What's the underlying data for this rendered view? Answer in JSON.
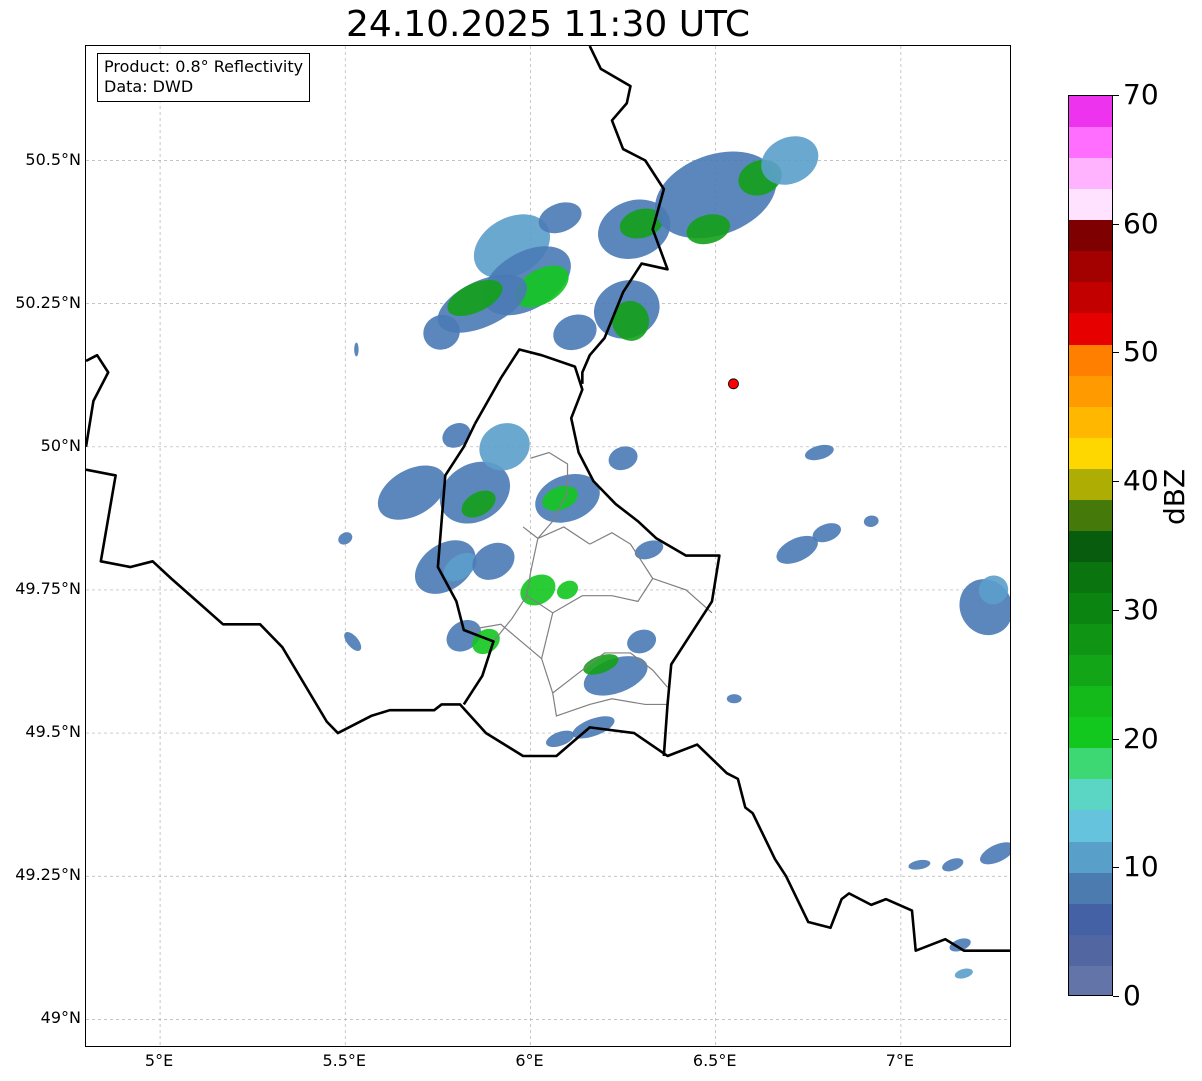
{
  "title": "24.10.2025 11:30 UTC",
  "info": {
    "line1": "Product: 0.8° Reflectivity",
    "line2": "Data: DWD"
  },
  "map": {
    "lon_range": [
      4.8,
      7.3
    ],
    "lat_range": [
      48.95,
      50.7
    ],
    "grid": true,
    "lat_ticks": [
      {
        "value": 50.5,
        "label": "50.5°N"
      },
      {
        "value": 50.25,
        "label": "50.25°N"
      },
      {
        "value": 50.0,
        "label": "50°N"
      },
      {
        "value": 49.75,
        "label": "49.75°N"
      },
      {
        "value": 49.5,
        "label": "49.5°N"
      },
      {
        "value": 49.25,
        "label": "49.25°N"
      },
      {
        "value": 49.0,
        "label": "49°N"
      }
    ],
    "lon_ticks": [
      {
        "value": 5.0,
        "label": "5°E"
      },
      {
        "value": 5.5,
        "label": "5.5°E"
      },
      {
        "value": 6.0,
        "label": "6°E"
      },
      {
        "value": 6.5,
        "label": "6.5°E"
      },
      {
        "value": 7.0,
        "label": "7°E"
      }
    ],
    "radar_site": {
      "lon": 6.548,
      "lat": 50.11,
      "color": "#ff0000"
    },
    "borders": [
      [
        [
          4.8,
          49.96
        ],
        [
          4.88,
          49.95
        ],
        [
          4.84,
          49.8
        ],
        [
          4.92,
          49.79
        ],
        [
          4.98,
          49.8
        ],
        [
          5.03,
          49.77
        ],
        [
          5.1,
          49.73
        ],
        [
          5.17,
          49.69
        ],
        [
          5.27,
          49.69
        ],
        [
          5.33,
          49.65
        ],
        [
          5.45,
          49.52
        ],
        [
          5.48,
          49.5
        ],
        [
          5.57,
          49.53
        ],
        [
          5.62,
          49.54
        ],
        [
          5.74,
          49.54
        ],
        [
          5.76,
          49.55
        ],
        [
          5.81,
          49.55
        ],
        [
          5.88,
          49.5
        ],
        [
          5.98,
          49.46
        ],
        [
          6.07,
          49.46
        ],
        [
          6.16,
          49.51
        ],
        [
          6.28,
          49.5
        ],
        [
          6.37,
          49.46
        ],
        [
          6.45,
          49.48
        ],
        [
          6.53,
          49.43
        ],
        [
          6.56,
          49.42
        ],
        [
          6.58,
          49.37
        ],
        [
          6.6,
          49.36
        ],
        [
          6.66,
          49.28
        ],
        [
          6.69,
          49.25
        ],
        [
          6.75,
          49.17
        ],
        [
          6.81,
          49.16
        ],
        [
          6.84,
          49.21
        ],
        [
          6.86,
          49.22
        ],
        [
          6.92,
          49.2
        ],
        [
          6.96,
          49.21
        ],
        [
          7.03,
          49.19
        ],
        [
          7.04,
          49.12
        ],
        [
          7.08,
          49.13
        ],
        [
          7.12,
          49.14
        ],
        [
          7.17,
          49.12
        ],
        [
          7.22,
          49.12
        ],
        [
          7.3,
          49.12
        ]
      ],
      [
        [
          5.85,
          50.04
        ],
        [
          5.92,
          50.12
        ],
        [
          5.97,
          50.17
        ],
        [
          6.03,
          50.16
        ],
        [
          6.12,
          50.14
        ],
        [
          6.14,
          50.1
        ],
        [
          6.11,
          50.05
        ],
        [
          6.13,
          49.99
        ],
        [
          6.17,
          49.94
        ],
        [
          6.23,
          49.9
        ],
        [
          6.29,
          49.87
        ],
        [
          6.34,
          49.84
        ],
        [
          6.42,
          49.81
        ],
        [
          6.51,
          49.81
        ],
        [
          6.49,
          49.73
        ],
        [
          6.45,
          49.69
        ],
        [
          6.38,
          49.62
        ],
        [
          6.37,
          49.55
        ],
        [
          6.36,
          49.46
        ]
      ],
      [
        [
          5.85,
          50.04
        ],
        [
          5.82,
          50.0
        ],
        [
          5.77,
          49.95
        ],
        [
          5.76,
          49.87
        ],
        [
          5.75,
          49.79
        ],
        [
          5.8,
          49.73
        ],
        [
          5.82,
          49.68
        ],
        [
          5.9,
          49.66
        ],
        [
          5.87,
          49.6
        ],
        [
          5.82,
          49.55
        ]
      ],
      [
        [
          6.14,
          50.11
        ],
        [
          6.14,
          50.13
        ],
        [
          6.16,
          50.16
        ],
        [
          6.2,
          50.19
        ],
        [
          6.25,
          50.27
        ],
        [
          6.3,
          50.32
        ],
        [
          6.37,
          50.31
        ],
        [
          6.33,
          50.38
        ],
        [
          6.36,
          50.45
        ],
        [
          6.31,
          50.5
        ],
        [
          6.25,
          50.52
        ],
        [
          6.22,
          50.57
        ],
        [
          6.26,
          50.6
        ],
        [
          6.27,
          50.63
        ],
        [
          6.19,
          50.66
        ],
        [
          6.16,
          50.7
        ]
      ],
      [
        [
          4.8,
          50.15
        ],
        [
          4.83,
          50.16
        ],
        [
          4.86,
          50.13
        ],
        [
          4.82,
          50.08
        ],
        [
          4.8,
          50.0
        ]
      ]
    ],
    "regions": [
      [
        [
          6.0,
          49.98
        ],
        [
          6.05,
          49.99
        ],
        [
          6.1,
          49.97
        ],
        [
          6.1,
          49.92
        ],
        [
          6.06,
          49.87
        ],
        [
          6.02,
          49.84
        ],
        [
          6.0,
          49.78
        ],
        [
          5.99,
          49.74
        ]
      ],
      [
        [
          5.99,
          49.74
        ],
        [
          6.06,
          49.71
        ],
        [
          6.14,
          49.74
        ],
        [
          6.22,
          49.74
        ],
        [
          6.29,
          49.73
        ],
        [
          6.33,
          49.77
        ],
        [
          6.42,
          49.75
        ],
        [
          6.49,
          49.71
        ]
      ],
      [
        [
          6.06,
          49.71
        ],
        [
          6.03,
          49.63
        ],
        [
          6.06,
          49.57
        ],
        [
          6.07,
          49.53
        ],
        [
          6.16,
          49.55
        ],
        [
          6.22,
          49.56
        ],
        [
          6.31,
          49.55
        ],
        [
          6.37,
          49.55
        ]
      ],
      [
        [
          6.06,
          49.57
        ],
        [
          6.12,
          49.6
        ],
        [
          6.2,
          49.64
        ],
        [
          6.27,
          49.64
        ],
        [
          6.33,
          49.61
        ],
        [
          6.37,
          49.58
        ]
      ],
      [
        [
          6.16,
          49.83
        ],
        [
          6.22,
          49.85
        ],
        [
          6.27,
          49.83
        ],
        [
          6.3,
          49.8
        ],
        [
          6.33,
          49.77
        ]
      ],
      [
        [
          5.9,
          49.66
        ],
        [
          5.95,
          49.7
        ],
        [
          5.99,
          49.74
        ]
      ],
      [
        [
          5.98,
          49.86
        ],
        [
          6.02,
          49.84
        ],
        [
          6.09,
          49.86
        ],
        [
          6.16,
          49.83
        ]
      ],
      [
        [
          5.83,
          49.68
        ],
        [
          5.92,
          49.69
        ],
        [
          6.03,
          49.63
        ]
      ]
    ],
    "echoes": [
      {
        "lon": 5.95,
        "lat": 50.35,
        "rlon": 0.11,
        "rlat": 0.05,
        "rot": -30,
        "color": "#5b9fcb"
      },
      {
        "lon": 5.99,
        "lat": 50.29,
        "rlon": 0.13,
        "rlat": 0.05,
        "rot": -30,
        "color": "#4a7ab5"
      },
      {
        "lon": 6.03,
        "lat": 50.28,
        "rlon": 0.08,
        "rlat": 0.03,
        "rot": -30,
        "color": "#13c71f"
      },
      {
        "lon": 5.87,
        "lat": 50.25,
        "rlon": 0.13,
        "rlat": 0.04,
        "rot": -25,
        "color": "#4a7ab5"
      },
      {
        "lon": 5.85,
        "lat": 50.26,
        "rlon": 0.08,
        "rlat": 0.025,
        "rot": -25,
        "color": "#13a118"
      },
      {
        "lon": 5.76,
        "lat": 50.2,
        "rlon": 0.05,
        "rlat": 0.03,
        "rot": -25,
        "color": "#4a7ab5"
      },
      {
        "lon": 6.12,
        "lat": 50.2,
        "rlon": 0.06,
        "rlat": 0.03,
        "rot": -20,
        "color": "#4a7ab5"
      },
      {
        "lon": 6.08,
        "lat": 50.4,
        "rlon": 0.06,
        "rlat": 0.025,
        "rot": -20,
        "color": "#4a7ab5"
      },
      {
        "lon": 6.28,
        "lat": 50.38,
        "rlon": 0.1,
        "rlat": 0.05,
        "rot": -20,
        "color": "#4a7ab5"
      },
      {
        "lon": 6.3,
        "lat": 50.39,
        "rlon": 0.06,
        "rlat": 0.025,
        "rot": -15,
        "color": "#13a118"
      },
      {
        "lon": 6.26,
        "lat": 50.24,
        "rlon": 0.09,
        "rlat": 0.05,
        "rot": -20,
        "color": "#4a7ab5"
      },
      {
        "lon": 6.27,
        "lat": 50.22,
        "rlon": 0.05,
        "rlat": 0.035,
        "rot": -10,
        "color": "#13a118"
      },
      {
        "lon": 6.5,
        "lat": 50.44,
        "rlon": 0.17,
        "rlat": 0.07,
        "rot": -20,
        "color": "#4a7ab5"
      },
      {
        "lon": 6.48,
        "lat": 50.38,
        "rlon": 0.06,
        "rlat": 0.025,
        "rot": -15,
        "color": "#13a118"
      },
      {
        "lon": 6.62,
        "lat": 50.47,
        "rlon": 0.06,
        "rlat": 0.03,
        "rot": -20,
        "color": "#13a118"
      },
      {
        "lon": 6.7,
        "lat": 50.5,
        "rlon": 0.08,
        "rlat": 0.04,
        "rot": -25,
        "color": "#5b9fcb"
      },
      {
        "lon": 5.68,
        "lat": 49.92,
        "rlon": 0.1,
        "rlat": 0.04,
        "rot": -30,
        "color": "#4a7ab5"
      },
      {
        "lon": 5.85,
        "lat": 49.92,
        "rlon": 0.1,
        "rlat": 0.05,
        "rot": -30,
        "color": "#4a7ab5"
      },
      {
        "lon": 5.86,
        "lat": 49.9,
        "rlon": 0.05,
        "rlat": 0.02,
        "rot": -30,
        "color": "#13a118"
      },
      {
        "lon": 5.93,
        "lat": 50.0,
        "rlon": 0.07,
        "rlat": 0.04,
        "rot": -30,
        "color": "#5b9fcb"
      },
      {
        "lon": 5.8,
        "lat": 50.02,
        "rlon": 0.04,
        "rlat": 0.02,
        "rot": -30,
        "color": "#4a7ab5"
      },
      {
        "lon": 6.1,
        "lat": 49.91,
        "rlon": 0.09,
        "rlat": 0.04,
        "rot": -20,
        "color": "#4a7ab5"
      },
      {
        "lon": 6.08,
        "lat": 49.91,
        "rlon": 0.05,
        "rlat": 0.02,
        "rot": -20,
        "color": "#13c71f"
      },
      {
        "lon": 6.25,
        "lat": 49.98,
        "rlon": 0.04,
        "rlat": 0.02,
        "rot": -20,
        "color": "#4a7ab5"
      },
      {
        "lon": 5.77,
        "lat": 49.79,
        "rlon": 0.09,
        "rlat": 0.04,
        "rot": -35,
        "color": "#4a7ab5"
      },
      {
        "lon": 5.81,
        "lat": 49.79,
        "rlon": 0.05,
        "rlat": 0.02,
        "rot": -35,
        "color": "#5b9fcb"
      },
      {
        "lon": 5.9,
        "lat": 49.8,
        "rlon": 0.06,
        "rlat": 0.03,
        "rot": -30,
        "color": "#4a7ab5"
      },
      {
        "lon": 6.02,
        "lat": 49.75,
        "rlon": 0.05,
        "rlat": 0.025,
        "rot": -30,
        "color": "#13c71f"
      },
      {
        "lon": 6.1,
        "lat": 49.75,
        "rlon": 0.03,
        "rlat": 0.015,
        "rot": -30,
        "color": "#13c71f"
      },
      {
        "lon": 5.82,
        "lat": 49.67,
        "rlon": 0.05,
        "rlat": 0.025,
        "rot": -35,
        "color": "#4a7ab5"
      },
      {
        "lon": 5.88,
        "lat": 49.66,
        "rlon": 0.04,
        "rlat": 0.02,
        "rot": -35,
        "color": "#13c71f"
      },
      {
        "lon": 6.23,
        "lat": 49.6,
        "rlon": 0.09,
        "rlat": 0.03,
        "rot": -20,
        "color": "#4a7ab5"
      },
      {
        "lon": 6.19,
        "lat": 49.62,
        "rlon": 0.05,
        "rlat": 0.015,
        "rot": -20,
        "color": "#13a118"
      },
      {
        "lon": 6.3,
        "lat": 49.66,
        "rlon": 0.04,
        "rlat": 0.02,
        "rot": -20,
        "color": "#4a7ab5"
      },
      {
        "lon": 6.17,
        "lat": 49.51,
        "rlon": 0.06,
        "rlat": 0.015,
        "rot": -20,
        "color": "#4a7ab5"
      },
      {
        "lon": 6.08,
        "lat": 49.49,
        "rlon": 0.04,
        "rlat": 0.012,
        "rot": -20,
        "color": "#4a7ab5"
      },
      {
        "lon": 6.32,
        "lat": 49.82,
        "rlon": 0.04,
        "rlat": 0.015,
        "rot": -20,
        "color": "#4a7ab5"
      },
      {
        "lon": 6.72,
        "lat": 49.82,
        "rlon": 0.06,
        "rlat": 0.02,
        "rot": -25,
        "color": "#4a7ab5"
      },
      {
        "lon": 6.8,
        "lat": 49.85,
        "rlon": 0.04,
        "rlat": 0.015,
        "rot": -20,
        "color": "#4a7ab5"
      },
      {
        "lon": 6.78,
        "lat": 49.99,
        "rlon": 0.04,
        "rlat": 0.012,
        "rot": -15,
        "color": "#4a7ab5"
      },
      {
        "lon": 7.23,
        "lat": 49.72,
        "rlon": 0.07,
        "rlat": 0.05,
        "rot": -30,
        "color": "#4a7ab5"
      },
      {
        "lon": 7.25,
        "lat": 49.75,
        "rlon": 0.04,
        "rlat": 0.025,
        "rot": -30,
        "color": "#5b9fcb"
      },
      {
        "lon": 7.05,
        "lat": 49.27,
        "rlon": 0.03,
        "rlat": 0.008,
        "rot": -10,
        "color": "#4a7ab5"
      },
      {
        "lon": 7.14,
        "lat": 49.27,
        "rlon": 0.03,
        "rlat": 0.01,
        "rot": -20,
        "color": "#4a7ab5"
      },
      {
        "lon": 7.26,
        "lat": 49.29,
        "rlon": 0.05,
        "rlat": 0.015,
        "rot": -25,
        "color": "#4a7ab5"
      },
      {
        "lon": 7.16,
        "lat": 49.13,
        "rlon": 0.03,
        "rlat": 0.01,
        "rot": -20,
        "color": "#4a7ab5"
      },
      {
        "lon": 7.17,
        "lat": 49.08,
        "rlon": 0.025,
        "rlat": 0.008,
        "rot": -15,
        "color": "#5b9fcb"
      },
      {
        "lon": 6.92,
        "lat": 49.87,
        "rlon": 0.02,
        "rlat": 0.01,
        "rot": -10,
        "color": "#4a7ab5"
      },
      {
        "lon": 6.55,
        "lat": 49.56,
        "rlon": 0.02,
        "rlat": 0.008,
        "rot": 0,
        "color": "#4a7ab5"
      },
      {
        "lon": 5.52,
        "lat": 49.66,
        "rlon": 0.015,
        "rlat": 0.02,
        "rot": -40,
        "color": "#4a7ab5"
      },
      {
        "lon": 5.5,
        "lat": 49.84,
        "rlon": 0.02,
        "rlat": 0.01,
        "rot": -30,
        "color": "#4a7ab5"
      },
      {
        "lon": 5.53,
        "lat": 50.17,
        "rlon": 0.006,
        "rlat": 0.012,
        "rot": 0,
        "color": "#4a7ab5"
      }
    ]
  },
  "colorbar": {
    "label": "dBZ",
    "min": 0,
    "max": 70,
    "ticks": [
      "0",
      "10",
      "20",
      "30",
      "40",
      "50",
      "60",
      "70"
    ],
    "colors": [
      "#6375a8",
      "#5267a1",
      "#4361a4",
      "#4c7bb0",
      "#589fca",
      "#66c3dd",
      "#5bd5c4",
      "#3dd874",
      "#12c81e",
      "#13ba1a",
      "#12a517",
      "#0f9414",
      "#0c8411",
      "#0a740f",
      "#075d0d",
      "#457a0b",
      "#adad03",
      "#ffd700",
      "#ffb700",
      "#ff9a00",
      "#ff7f00",
      "#e60000",
      "#c30000",
      "#a30000",
      "#7f0000",
      "#ffe2ff",
      "#ffb3ff",
      "#ff6eff",
      "#ee33ee"
    ]
  }
}
